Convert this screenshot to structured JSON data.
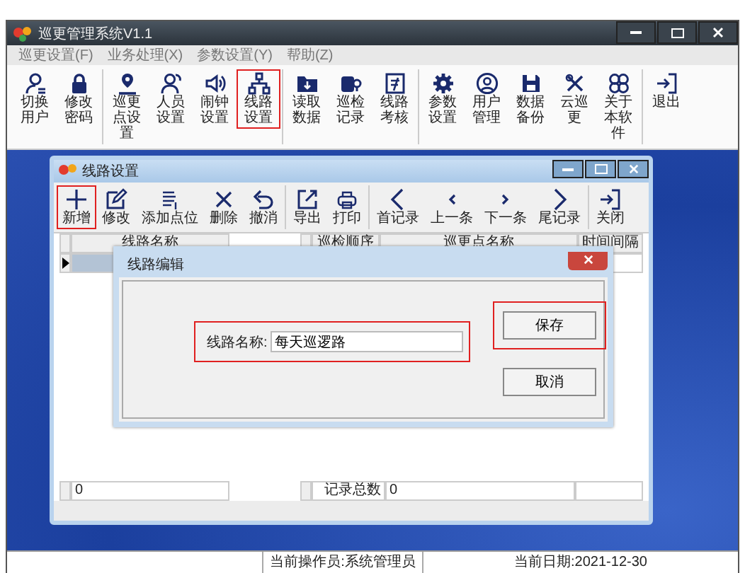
{
  "app": {
    "title": "巡更管理系统V1.1",
    "menu": [
      "巡更设置(F)",
      "业务处理(X)",
      "参数设置(Y)",
      "帮助(Z)"
    ],
    "toolbar_groups": [
      [
        {
          "label": "切换用户",
          "kind": "user",
          "highlighted": false
        },
        {
          "label": "修改密码",
          "kind": "lock",
          "highlighted": false
        }
      ],
      [
        {
          "label": "巡更点设置",
          "kind": "pin-person",
          "highlighted": false
        },
        {
          "label": "人员设置",
          "kind": "people",
          "highlighted": false
        },
        {
          "label": "闹钟设置",
          "kind": "speaker",
          "highlighted": false
        },
        {
          "label": "线路设置",
          "kind": "network",
          "highlighted": true
        }
      ],
      [
        {
          "label": "读取数据",
          "kind": "folder-down",
          "highlighted": false
        },
        {
          "label": "巡检记录",
          "kind": "tag",
          "highlighted": false
        },
        {
          "label": "线路考核",
          "kind": "doc-check",
          "highlighted": false
        }
      ],
      [
        {
          "label": "参数设置",
          "kind": "gear",
          "highlighted": false
        },
        {
          "label": "用户管理",
          "kind": "user-circle",
          "highlighted": false
        },
        {
          "label": "数据备份",
          "kind": "floppy",
          "highlighted": false
        },
        {
          "label": "云巡更",
          "kind": "tools",
          "highlighted": false
        },
        {
          "label": "关于本软件",
          "kind": "clover",
          "highlighted": false
        }
      ],
      [
        {
          "label": "退出",
          "kind": "exit",
          "highlighted": false
        }
      ]
    ]
  },
  "route_window": {
    "title": "线路设置",
    "toolbar_groups": [
      [
        {
          "label": "新增",
          "kind": "plus",
          "highlighted": true
        },
        {
          "label": "修改",
          "kind": "edit",
          "highlighted": false
        },
        {
          "label": "添加点位",
          "kind": "list-add",
          "highlighted": false
        },
        {
          "label": "删除",
          "kind": "cross",
          "highlighted": false
        },
        {
          "label": "撤消",
          "kind": "undo",
          "highlighted": false
        }
      ],
      [
        {
          "label": "导出",
          "kind": "export",
          "highlighted": false
        },
        {
          "label": "打印",
          "kind": "printer",
          "highlighted": false
        }
      ],
      [
        {
          "label": "首记录",
          "kind": "chevron-left-big",
          "highlighted": false
        },
        {
          "label": "上一条",
          "kind": "chevron-left",
          "highlighted": false
        },
        {
          "label": "下一条",
          "kind": "chevron-right",
          "highlighted": false
        },
        {
          "label": "尾记录",
          "kind": "chevron-right-big",
          "highlighted": false
        }
      ],
      [
        {
          "label": "关闭",
          "kind": "exit",
          "highlighted": false
        }
      ]
    ],
    "routes_table": {
      "columns": [
        "线路名称"
      ],
      "rows": [
        {
          "selected": true
        }
      ],
      "footer": "0"
    },
    "points_table": {
      "columns": [
        "巡检顺序",
        "巡更点名称",
        "时间间隔"
      ],
      "footer_label": "记录总数",
      "footer_value": "0"
    }
  },
  "dialog": {
    "title": "线路编辑",
    "field_label": "线路名称:",
    "field_value": "每天巡逻路",
    "field_highlighted": true,
    "buttons": [
      {
        "label": "保存",
        "highlighted": true
      },
      {
        "label": "取消",
        "highlighted": false
      }
    ]
  },
  "status_bar": {
    "operator": "当前操作员:系统管理员",
    "date": "当前日期:2021-12-30"
  }
}
